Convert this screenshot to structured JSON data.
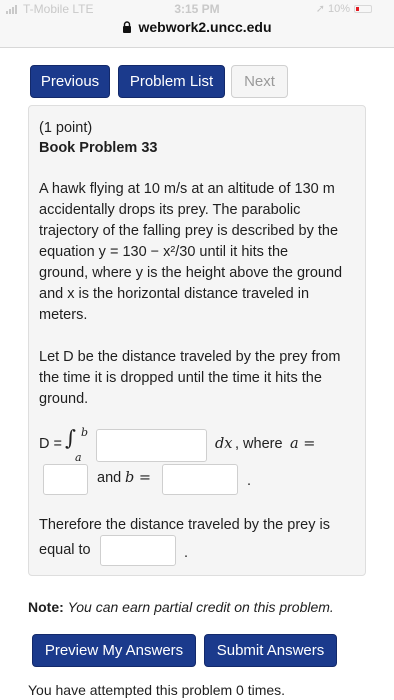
{
  "status_bar": {
    "carrier": "T-Mobile  LTE",
    "time": "3:15 PM",
    "battery": "10%",
    "url": "webwork2.uncc.edu"
  },
  "nav": {
    "previous": "Previous",
    "problem_list": "Problem List",
    "next": "Next"
  },
  "problem": {
    "points": "(1 point)",
    "title": "Book Problem 33",
    "p1_lines": [
      "A hawk flying at 10 m/s at an altitude of 130 m",
      "accidentally drops its prey. The parabolic",
      "trajectory of the falling prey is described by the",
      "equation y = 130 − x²/30   until it hits the",
      "ground, where y is the height above the ground",
      "and x is the horizontal distance traveled in",
      "meters."
    ],
    "p2_lines": [
      "Let D be the distance traveled by the prey from",
      "the time it is dropped until the time it hits the",
      "ground."
    ],
    "integral": {
      "lhs": "D = ",
      "integral_sign": "∫",
      "upper": "b",
      "lower": "a",
      "dx": "dx",
      "where": ", where",
      "a_eq": "a =",
      "and": "and",
      "b_eq": "b =",
      "period": "."
    },
    "p3_lines": [
      "Therefore the distance traveled by the prey is",
      "equal to"
    ],
    "p3_period": "."
  },
  "note": {
    "label": "Note:",
    "text": "You can earn partial credit on this problem."
  },
  "buttons": {
    "preview": "Preview My Answers",
    "submit": "Submit Answers"
  },
  "attempts": "You have attempted this problem 0 times.",
  "colors": {
    "primary": "#1b3a8c",
    "panel": "#f5f5f5"
  }
}
